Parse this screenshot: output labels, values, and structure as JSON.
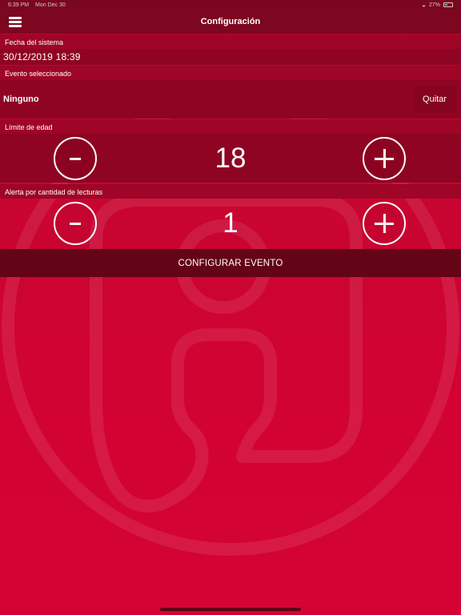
{
  "status_bar": {
    "time": "6:39 PM",
    "date": "Mon Dec 30",
    "battery": "27%"
  },
  "nav": {
    "title": "Configuración",
    "menu_icon": "hamburger-menu-icon"
  },
  "system_date": {
    "label": "Fecha del sistema",
    "value": "30/12/2019 18:39"
  },
  "selected_event": {
    "label": "Evento seleccionado",
    "value": "Ninguno",
    "remove_label": "Quitar"
  },
  "age_limit": {
    "label": "Límite de edad",
    "value": "18",
    "decrement_label": "-",
    "increment_label": "+"
  },
  "reading_alert": {
    "label": "Alerta por cantidad de lecturas",
    "value": "1",
    "decrement_label": "-",
    "increment_label": "+"
  },
  "configure_button": {
    "label": "CONFIGURAR EVENTO"
  },
  "colors": {
    "background": "#d10333",
    "nav_bar": "#7d0621",
    "section_label": "#9e0526",
    "value_row": "#8f0423",
    "configure_button": "#640417",
    "text": "#ffffff"
  }
}
